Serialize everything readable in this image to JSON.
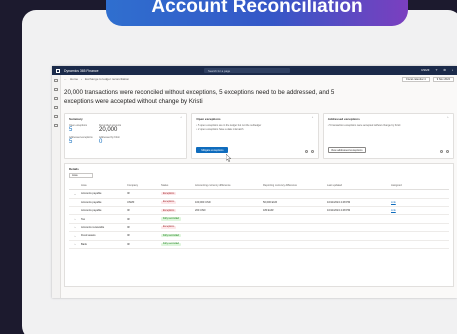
{
  "slide_title": "Account Reconciliation",
  "app": {
    "name": "Dynamics 365 Finance",
    "search_placeholder": "Search for a page",
    "top_right": [
      "USMF",
      "?",
      "⚙",
      "•"
    ]
  },
  "breadcrumb": {
    "items": [
      "Home",
      "›",
      "Exchange to ledger reconciliation"
    ],
    "period": "Fiscal calendar 4",
    "date": "9 Nov 2024"
  },
  "headline": "20,000 transactions were reconciled without exceptions, 5 exceptions need to be addressed, and 5 exceptions were accepted without change by Kristi",
  "summary": {
    "title": "Summary",
    "cells": [
      {
        "label": "Open exceptions",
        "value": "5",
        "link": true
      },
      {
        "label": "Reconciled accounts",
        "value": "20,000",
        "link": false
      },
      {
        "label": "Addressed exceptions",
        "value": "5",
        "link": true
      },
      {
        "label": "Addressed by Kristi",
        "value": "0",
        "link": true
      }
    ]
  },
  "open_exceptions": {
    "title": "Open exceptions",
    "bullets": [
      "5 open exceptions are in the ledger but not the subledger",
      "2 open exceptions have a date mismatch"
    ],
    "button": "Mitigate exceptions"
  },
  "addressed_exceptions": {
    "title": "Addressed exceptions",
    "bullets": [
      "5 transaction exceptions were accepted without change by Kristi"
    ],
    "button": "View addressed exceptions"
  },
  "details": {
    "title": "Details",
    "filter": "Area",
    "columns": [
      "",
      "Area",
      "Company",
      "Status",
      "Accounting currency difference",
      "Reporting currency difference",
      "Last updated",
      "Assigned"
    ],
    "rows": [
      {
        "chev": "⌄",
        "area": "Accounts payable",
        "company": "IR",
        "status": "Exceptions",
        "ok": false,
        "acc": "",
        "rep": "",
        "updated": "",
        "assigned": ""
      },
      {
        "chev": "",
        "area": "Accounts payable",
        "company": "USMF",
        "status": "Exceptions",
        "ok": false,
        "acc": "100,000 USD",
        "rep": "50,000 EUR",
        "updated": "10/11/2024 4:48 PM",
        "assigned": "Link"
      },
      {
        "chev": "",
        "area": "Accounts payable",
        "company": "IR",
        "status": "Exceptions",
        "ok": false,
        "acc": "200 USD",
        "rep": "180 EUR",
        "updated": "10/11/2024 4:48 PM",
        "assigned": "Link"
      },
      {
        "chev": "›",
        "area": "Tax",
        "company": "IR",
        "status": "Fully reconciled",
        "ok": true,
        "acc": "",
        "rep": "",
        "updated": "",
        "assigned": ""
      },
      {
        "chev": "›",
        "area": "Accounts receivable",
        "company": "IR",
        "status": "Exceptions",
        "ok": false,
        "acc": "",
        "rep": "",
        "updated": "",
        "assigned": ""
      },
      {
        "chev": "›",
        "area": "Fixed assets",
        "company": "IR",
        "status": "Fully reconciled",
        "ok": true,
        "acc": "",
        "rep": "",
        "updated": "",
        "assigned": ""
      },
      {
        "chev": "›",
        "area": "Bank",
        "company": "IR",
        "status": "Fully reconciled",
        "ok": true,
        "acc": "",
        "rep": "",
        "updated": "",
        "assigned": ""
      }
    ]
  }
}
